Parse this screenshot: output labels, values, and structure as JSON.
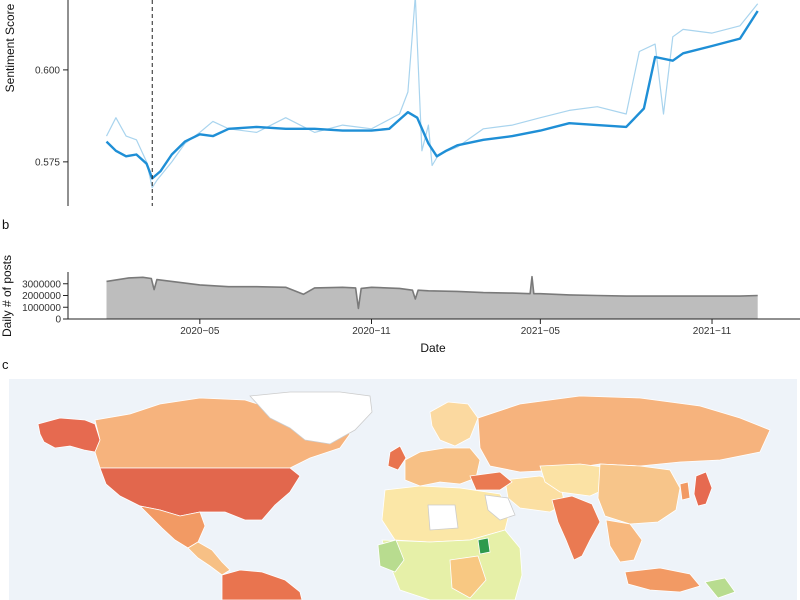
{
  "chart_data": [
    {
      "id": "a",
      "type": "line",
      "ylabel": "Sentiment Score",
      "y_ticks": [
        0.575,
        0.6
      ],
      "y_tick_labels": [
        "0.575",
        "0.600"
      ],
      "ylim": [
        0.563,
        0.619
      ],
      "x_domain": [
        "2020-01-15",
        "2021-12-31"
      ],
      "vline_date": "2020-03-11",
      "series": [
        {
          "role": "daily",
          "color": "#a9d4ee",
          "x": [
            "2020-01-22",
            "2020-02-01",
            "2020-02-12",
            "2020-02-23",
            "2020-03-05",
            "2020-03-11",
            "2020-03-16",
            "2020-04-01",
            "2020-04-15",
            "2020-05-01",
            "2020-05-15",
            "2020-06-01",
            "2020-07-01",
            "2020-08-01",
            "2020-09-01",
            "2020-10-01",
            "2020-11-01",
            "2020-12-01",
            "2020-12-10",
            "2020-12-18",
            "2020-12-25",
            "2021-01-01",
            "2021-01-05",
            "2021-01-12",
            "2021-02-01",
            "2021-03-01",
            "2021-04-01",
            "2021-05-01",
            "2021-06-01",
            "2021-07-01",
            "2021-08-01",
            "2021-08-15",
            "2021-09-01",
            "2021-09-10",
            "2021-09-20",
            "2021-10-01",
            "2021-11-01",
            "2021-12-01",
            "2021-12-20"
          ],
          "y": [
            0.582,
            0.587,
            0.582,
            0.581,
            0.575,
            0.568,
            0.57,
            0.575,
            0.58,
            0.583,
            0.586,
            0.584,
            0.583,
            0.587,
            0.583,
            0.585,
            0.584,
            0.588,
            0.594,
            0.62,
            0.578,
            0.585,
            0.574,
            0.577,
            0.579,
            0.584,
            0.585,
            0.587,
            0.589,
            0.59,
            0.588,
            0.605,
            0.607,
            0.588,
            0.609,
            0.611,
            0.61,
            0.612,
            0.618
          ]
        },
        {
          "role": "smoothed",
          "color": "#1f8fd6",
          "x": [
            "2020-01-22",
            "2020-02-01",
            "2020-02-12",
            "2020-02-23",
            "2020-03-05",
            "2020-03-11",
            "2020-03-20",
            "2020-04-01",
            "2020-04-15",
            "2020-05-01",
            "2020-05-15",
            "2020-06-01",
            "2020-07-01",
            "2020-08-01",
            "2020-09-01",
            "2020-10-01",
            "2020-11-01",
            "2020-11-20",
            "2020-12-01",
            "2020-12-10",
            "2020-12-20",
            "2021-01-01",
            "2021-01-10",
            "2021-01-20",
            "2021-02-01",
            "2021-03-01",
            "2021-04-01",
            "2021-05-01",
            "2021-06-01",
            "2021-07-01",
            "2021-08-01",
            "2021-08-20",
            "2021-09-01",
            "2021-09-20",
            "2021-10-01",
            "2021-11-01",
            "2021-12-01",
            "2021-12-20"
          ],
          "y": [
            0.5805,
            0.578,
            0.5765,
            0.577,
            0.5745,
            0.5705,
            0.5725,
            0.577,
            0.5805,
            0.5825,
            0.582,
            0.584,
            0.5845,
            0.584,
            0.584,
            0.5835,
            0.5835,
            0.584,
            0.5865,
            0.5885,
            0.587,
            0.58,
            0.5765,
            0.578,
            0.5795,
            0.581,
            0.582,
            0.5835,
            0.5855,
            0.585,
            0.5845,
            0.5895,
            0.6035,
            0.6025,
            0.6045,
            0.6065,
            0.6085,
            0.616
          ]
        }
      ]
    },
    {
      "id": "b",
      "type": "area",
      "xlabel": "Date",
      "ylabel": "Daily # of posts",
      "y_ticks": [
        0,
        1000000,
        2000000,
        3000000
      ],
      "y_tick_labels": [
        "0",
        "1000000",
        "2000000",
        "3000000"
      ],
      "ylim": [
        0,
        4000000
      ],
      "x_domain": [
        "2020-01-15",
        "2021-12-31"
      ],
      "x_ticks": [
        "2020-05-01",
        "2020-11-01",
        "2021-05-01",
        "2021-11-01"
      ],
      "x_tick_labels": [
        "2020−05",
        "2020−11",
        "2021−05",
        "2021−11"
      ],
      "fill_color": "#bdbdbd",
      "line_color": "#7a7a7a",
      "x": [
        "2020-01-22",
        "2020-02-15",
        "2020-03-01",
        "2020-03-10",
        "2020-03-13",
        "2020-03-16",
        "2020-04-01",
        "2020-05-01",
        "2020-06-01",
        "2020-07-01",
        "2020-08-01",
        "2020-08-20",
        "2020-09-01",
        "2020-10-01",
        "2020-10-15",
        "2020-10-18",
        "2020-10-21",
        "2020-11-01",
        "2020-12-01",
        "2020-12-15",
        "2020-12-18",
        "2020-12-21",
        "2021-01-01",
        "2021-02-01",
        "2021-03-01",
        "2021-04-01",
        "2021-04-20",
        "2021-04-22",
        "2021-04-24",
        "2021-05-01",
        "2021-06-01",
        "2021-07-01",
        "2021-08-01",
        "2021-09-01",
        "2021-10-01",
        "2021-11-01",
        "2021-12-01",
        "2021-12-20"
      ],
      "y": [
        3200000,
        3500000,
        3550000,
        3450000,
        2500000,
        3350000,
        3200000,
        2900000,
        2750000,
        2750000,
        2700000,
        2100000,
        2650000,
        2700000,
        2650000,
        900000,
        2600000,
        2700000,
        2600000,
        2450000,
        1700000,
        2450000,
        2400000,
        2350000,
        2250000,
        2200000,
        2150000,
        3600000,
        2150000,
        2150000,
        2050000,
        2000000,
        1950000,
        1950000,
        1950000,
        1950000,
        1950000,
        2000000
      ]
    }
  ],
  "panels": {
    "b": {
      "letter": "b"
    },
    "c": {
      "letter": "c"
    }
  },
  "map": {
    "ocean_color": "#eef3f9",
    "regions": [
      {
        "name": "alaska",
        "color": "#e66a50"
      },
      {
        "name": "canada",
        "color": "#f6b37d"
      },
      {
        "name": "greenland",
        "color": "#ffffff"
      },
      {
        "name": "usa",
        "color": "#e2674d"
      },
      {
        "name": "mexico",
        "color": "#f29a64"
      },
      {
        "name": "central-america",
        "color": "#f7c085"
      },
      {
        "name": "south-america",
        "color": "#e9744f"
      },
      {
        "name": "west-europe",
        "color": "#f7c085"
      },
      {
        "name": "uk",
        "color": "#e9744f"
      },
      {
        "name": "scandinavia",
        "color": "#fbd9a0"
      },
      {
        "name": "russia",
        "color": "#f6b37d"
      },
      {
        "name": "north-africa",
        "color": "#fbe7a7"
      },
      {
        "name": "sahara-white",
        "color": "#ffffff"
      },
      {
        "name": "africa-central",
        "color": "#e6f0a8"
      },
      {
        "name": "africa-green",
        "color": "#b8dc8f"
      },
      {
        "name": "africa-orange",
        "color": "#f8c882"
      },
      {
        "name": "middle-east",
        "color": "#fbdfa2"
      },
      {
        "name": "turkey",
        "color": "#ea7a52"
      },
      {
        "name": "arabia-white",
        "color": "#ffffff"
      },
      {
        "name": "eritrea",
        "color": "#2e9a4d"
      },
      {
        "name": "india",
        "color": "#ea7a52"
      },
      {
        "name": "china",
        "color": "#f7c58a"
      },
      {
        "name": "central-asia",
        "color": "#fbe2a4"
      },
      {
        "name": "japan",
        "color": "#e66a50"
      },
      {
        "name": "korea",
        "color": "#f29a64"
      },
      {
        "name": "se-asia",
        "color": "#f7b87e"
      },
      {
        "name": "indonesia",
        "color": "#f29a64"
      },
      {
        "name": "png",
        "color": "#b8dc8f"
      }
    ]
  }
}
